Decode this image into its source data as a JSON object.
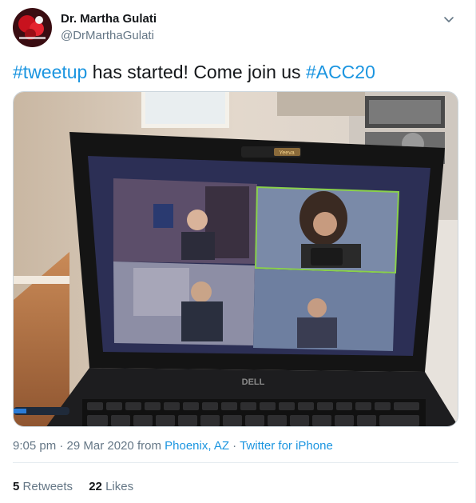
{
  "author": {
    "name": "Dr. Martha Gulati",
    "handle": "@DrMarthaGulati"
  },
  "tweet": {
    "hashtag1": "#tweetup",
    "middle": " has started! Come join us ",
    "hashtag2": "#ACC20"
  },
  "meta": {
    "time": "9:05 pm",
    "sep1": " · ",
    "date": "29 Mar 2020",
    "from": " from ",
    "location": "Phoenix, AZ",
    "sep2": " · ",
    "source": "Twitter for iPhone"
  },
  "stats": {
    "retweets_count": "5",
    "retweets_label": "Retweets",
    "likes_count": "22",
    "likes_label": "Likes"
  },
  "photo": {
    "webcam_label": "Yeeva",
    "laptop_brand": "DELL"
  },
  "colors": {
    "link": "#1b95e0",
    "secondary_text": "#657786",
    "divider": "#e6ecf0"
  }
}
